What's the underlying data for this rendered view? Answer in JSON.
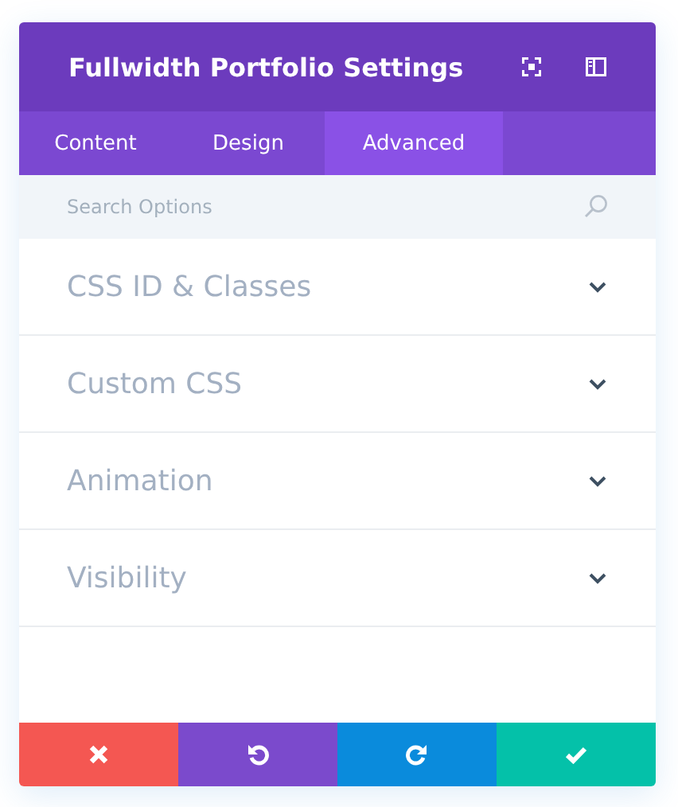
{
  "window": {
    "title": "Fullwidth Portfolio Settings"
  },
  "tabs": [
    {
      "label": "Content",
      "selected": false
    },
    {
      "label": "Design",
      "selected": false
    },
    {
      "label": "Advanced",
      "selected": true
    }
  ],
  "search": {
    "placeholder": "Search Options"
  },
  "sections": [
    {
      "title": "CSS ID & Classes",
      "expanded": false
    },
    {
      "title": "Custom CSS",
      "expanded": false
    },
    {
      "title": "Animation",
      "expanded": false
    },
    {
      "title": "Visibility",
      "expanded": false
    }
  ],
  "footer_buttons": [
    {
      "kind": "cancel",
      "color": "#f45752"
    },
    {
      "kind": "undo",
      "color": "#7b4acc"
    },
    {
      "kind": "redo",
      "color": "#0a8bdc"
    },
    {
      "kind": "save",
      "color": "#04c1a9"
    }
  ]
}
